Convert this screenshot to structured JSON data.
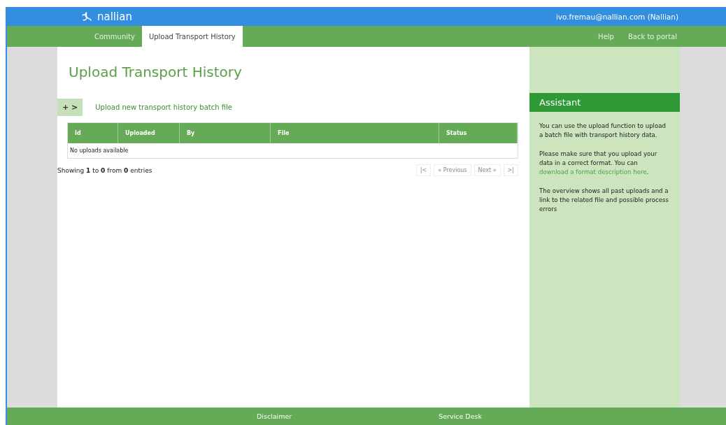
{
  "brand": {
    "name": "nallian"
  },
  "user": "ivo.fremau@nallian.com (Nallian)",
  "nav": {
    "tabs": [
      {
        "label": "Community",
        "selected": false
      },
      {
        "label": "Upload Transport History",
        "selected": true
      }
    ],
    "links": [
      "Help",
      "Back to portal"
    ]
  },
  "page_title": "Upload Transport History",
  "upload_action": {
    "toggle": "+ >",
    "label": "Upload new transport history batch file"
  },
  "table": {
    "columns": [
      "Id",
      "Uploaded",
      "By",
      "File",
      "Status"
    ],
    "empty_message": "No uploads available"
  },
  "info": "Showing **1** to **0** from **0** entries",
  "pagination": [
    {
      "label": "|<",
      "disabled": true
    },
    {
      "label": "« Previous",
      "disabled": true
    },
    {
      "label": "Next »",
      "disabled": true
    },
    {
      "label": ">|",
      "disabled": true
    }
  ],
  "assistant": {
    "title": "Assistant",
    "paragraphs": [
      {
        "text": "You can use the upload function to upload a batch file with transport history data."
      },
      {
        "text": "Please make sure that you upload your data in a correct format. You can ",
        "link": "download a format description here",
        "after": "."
      },
      {
        "text": "The overview shows all past uploads and a link to the related file and possible process errors"
      }
    ]
  },
  "footer": [
    "Disclaimer",
    "Service Desk"
  ]
}
